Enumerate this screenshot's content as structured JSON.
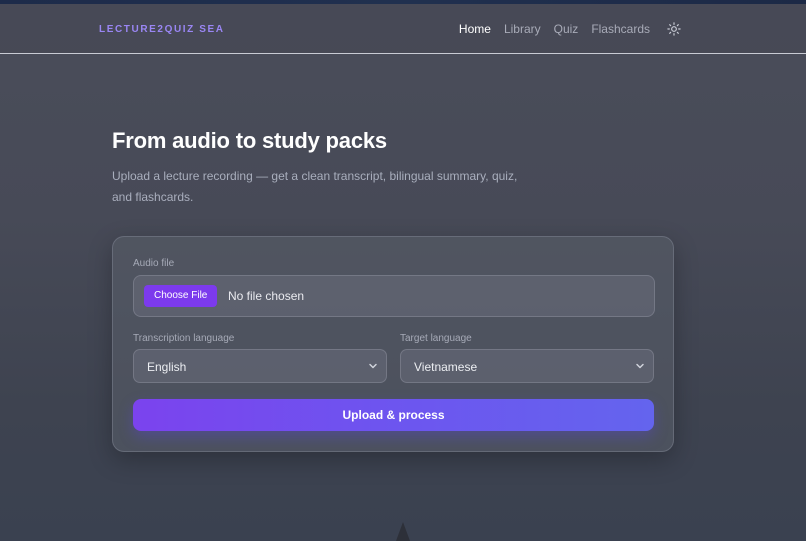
{
  "brand": "LECTURE2QUIZ SEA",
  "nav": {
    "items": [
      {
        "label": "Home",
        "active": true
      },
      {
        "label": "Library",
        "active": false
      },
      {
        "label": "Quiz",
        "active": false
      },
      {
        "label": "Flashcards",
        "active": false
      }
    ],
    "theme_icon": "sun-icon"
  },
  "hero": {
    "title": "From audio to study packs",
    "subtitle": "Upload a lecture recording — get a clean transcript, bilingual summary, quiz, and flashcards."
  },
  "form": {
    "audio_label": "Audio file",
    "choose_button": "Choose File",
    "file_status": "No file chosen",
    "transcription_label": "Transcription language",
    "transcription_value": "English",
    "target_label": "Target language",
    "target_value": "Vietnamese",
    "submit_label": "Upload & process"
  },
  "colors": {
    "accent": "#7c3aed",
    "brand": "#9a86f4",
    "button_gradient_start": "#7b43ee",
    "button_gradient_end": "#6464ee"
  }
}
